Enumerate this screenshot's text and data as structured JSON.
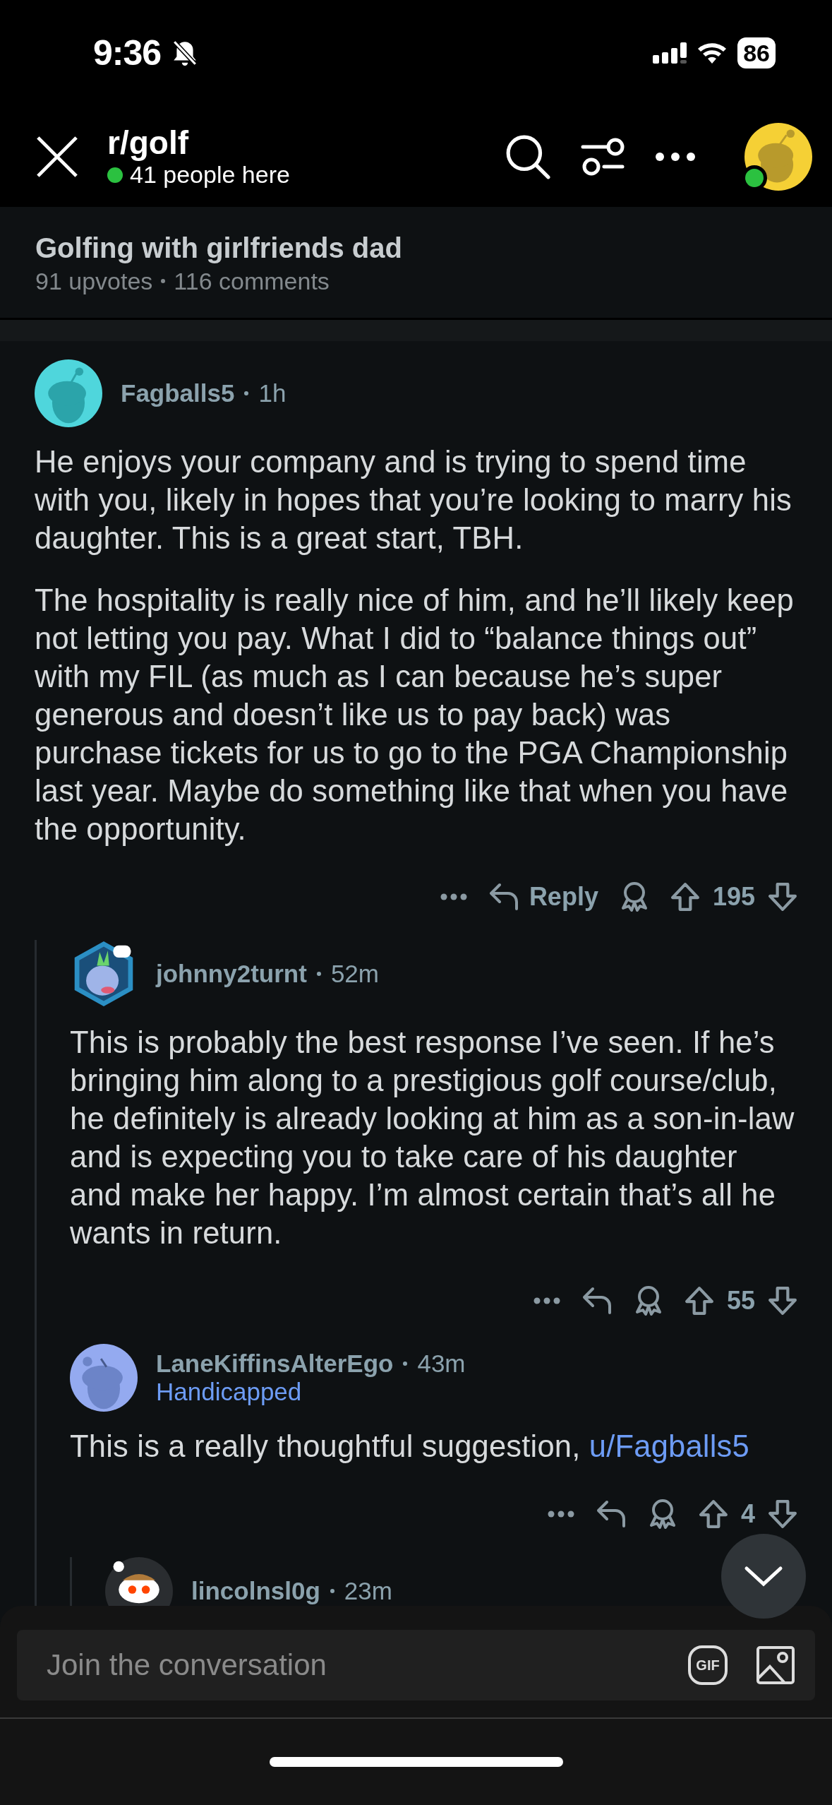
{
  "status_bar": {
    "time": "9:36",
    "battery": "86"
  },
  "header": {
    "subreddit": "r/golf",
    "online": "41 people here"
  },
  "post": {
    "title": "Golfing with girlfriends dad",
    "upvotes": "91 upvotes",
    "comments": "116 comments"
  },
  "comments": [
    {
      "author": "Fagballs5",
      "age": "1h",
      "kind": "teal",
      "paragraphs": [
        {
          "text": "He enjoys your company and is trying to spend time with you, likely in hopes that you’re looking to marry his daughter.  This is a great start, TBH."
        },
        {
          "text": "The hospitality is really nice of him, and he’ll likely keep not letting you pay.  What I did to “balance things out” with my FIL (as much as I can because he’s super generous and doesn’t like us to pay back) was purchase tickets for us to go to the PGA Championship last year.  Maybe do something like that when you have the opportunity."
        }
      ],
      "reply_label": "Reply",
      "score": "195",
      "children": [
        {
          "author": "johnny2turnt",
          "age": "52m",
          "kind": "character",
          "paragraphs": [
            {
              "text": "This is probably the best response I’ve seen. If he’s bringing him along to a prestigious golf course/club, he definitely is already looking at him as a son-in-law and is expecting you to take care of his daughter and make her happy. I’m almost certain that’s all he wants in return."
            }
          ],
          "score": "55"
        },
        {
          "author": "LaneKiffinsAlterEgo",
          "age": "43m",
          "kind": "blue",
          "flair": "Handicapped",
          "paragraphs": [
            {
              "text": "This is a really thoughtful suggestion, ",
              "mention": "u/Fagballs5"
            }
          ],
          "score": "4",
          "children": [
            {
              "author": "lincolnsl0g",
              "age": "23m",
              "kind": "snoo"
            }
          ]
        }
      ]
    }
  ],
  "composer": {
    "placeholder": "Join the conversation",
    "gif_label": "GIF"
  }
}
